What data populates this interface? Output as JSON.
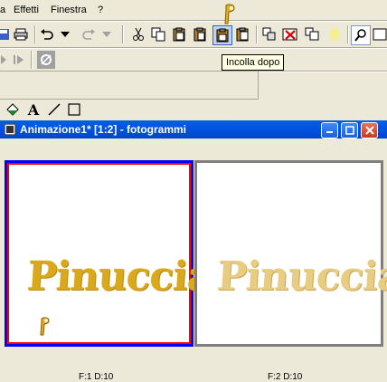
{
  "menu": {
    "effects": "Effetti",
    "window": "Finestra",
    "help": "?"
  },
  "tooltip": "Incolla dopo",
  "window": {
    "title": "Animazione1* [1:2] - fotogrammi"
  },
  "frames": [
    {
      "text": "Pinuccia",
      "caption": "F:1  D:10"
    },
    {
      "text": "Pinuccia",
      "caption": "F:2  D:10"
    }
  ],
  "colors": {
    "selected_frame_border": "#0000ff",
    "selected_frame_inner": "#ff0000",
    "title_bar": "#0054e3",
    "text_gold": "#d9a81c"
  }
}
